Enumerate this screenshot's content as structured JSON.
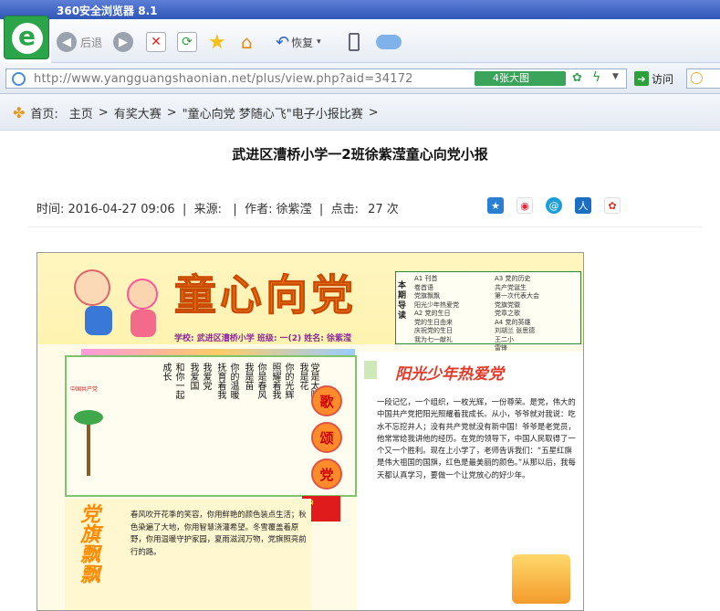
{
  "browser": {
    "title": "360安全浏览器 8.1",
    "back_label": "后退",
    "restore_label": "恢复",
    "url": "http://www.yangguangshaonian.net/plus/view.php?aid=34172",
    "big_image_label": "4张大图",
    "go_label": "访问"
  },
  "breadcrumb": {
    "prefix": "首页:",
    "items": [
      "主页",
      ">",
      "有奖大赛",
      ">",
      "\"童心向党 梦随心飞\"电子小报比赛",
      ">"
    ]
  },
  "article": {
    "title": "武进区漕桥小学一2班徐紫滢童心向党小报",
    "time_label": "时间:",
    "time": "2016-04-27 09:06",
    "source_label": "来源:",
    "author_label": "作者:",
    "author": "徐紫滢",
    "clicks_label": "点击:",
    "clicks": "27 次"
  },
  "poster": {
    "title": "童心向党",
    "school_line": "学校: 武进区漕桥小学 班级: 一(2) 姓名: 徐紫滢",
    "guide_side": "本期导读",
    "guide_col1": [
      "A1 刊首",
      "卷首语",
      "党旗飘飘",
      "阳光少年热爱党",
      "A2 党的生日",
      "党的生日由来",
      "庆祝党的生日",
      "我为七一献礼"
    ],
    "guide_col2": [
      "A3 党的历史",
      "共产党诞生",
      "第一次代表大会",
      "党旗党徽",
      "党章之歌",
      "A4 党的英雄",
      "刘胡兰  张思德",
      "王二小",
      "雷锋"
    ],
    "sun_title": "阳光少年热爱党",
    "sun_text": "一段记忆，一个组织，一枚光辉，一份尊荣。是党，伟大的中国共产党把阳光照耀着我成长。从小，爷爷就对我说：吃水不忘挖井人；没有共产党就没有新中国！爷爷是老党员，他常常给我讲他的经历。在党的领导下，中国人民取得了一个又一个胜利。现在上小学了，老师告诉我们：“五星红旗是伟大祖国的国旗，红色是最美丽的颜色。”从那以后，我每天都认真学习，要做一个让党放心的好少年。",
    "praise": [
      "歌",
      "颂",
      "党"
    ],
    "flag_title": "党旗飘飘",
    "flag_text": "春风吹开花季的笑容，你用鲜艳的颜色装点生活；秋色染遍了大地，你用智慧浇灌希望。冬雪覆盖着原野，你用温暖守护家园，夏雨滋润万物，党旗照亮前行的路。",
    "left_columns": [
      "党是太阳",
      "我是花",
      "你的光辉",
      "照耀着我",
      "你是春风",
      "我是苗",
      "你的温暖",
      "抚育着我",
      "我爱党",
      "我爱国",
      "和你一起",
      "成长"
    ],
    "side_label": "中国共产党"
  }
}
